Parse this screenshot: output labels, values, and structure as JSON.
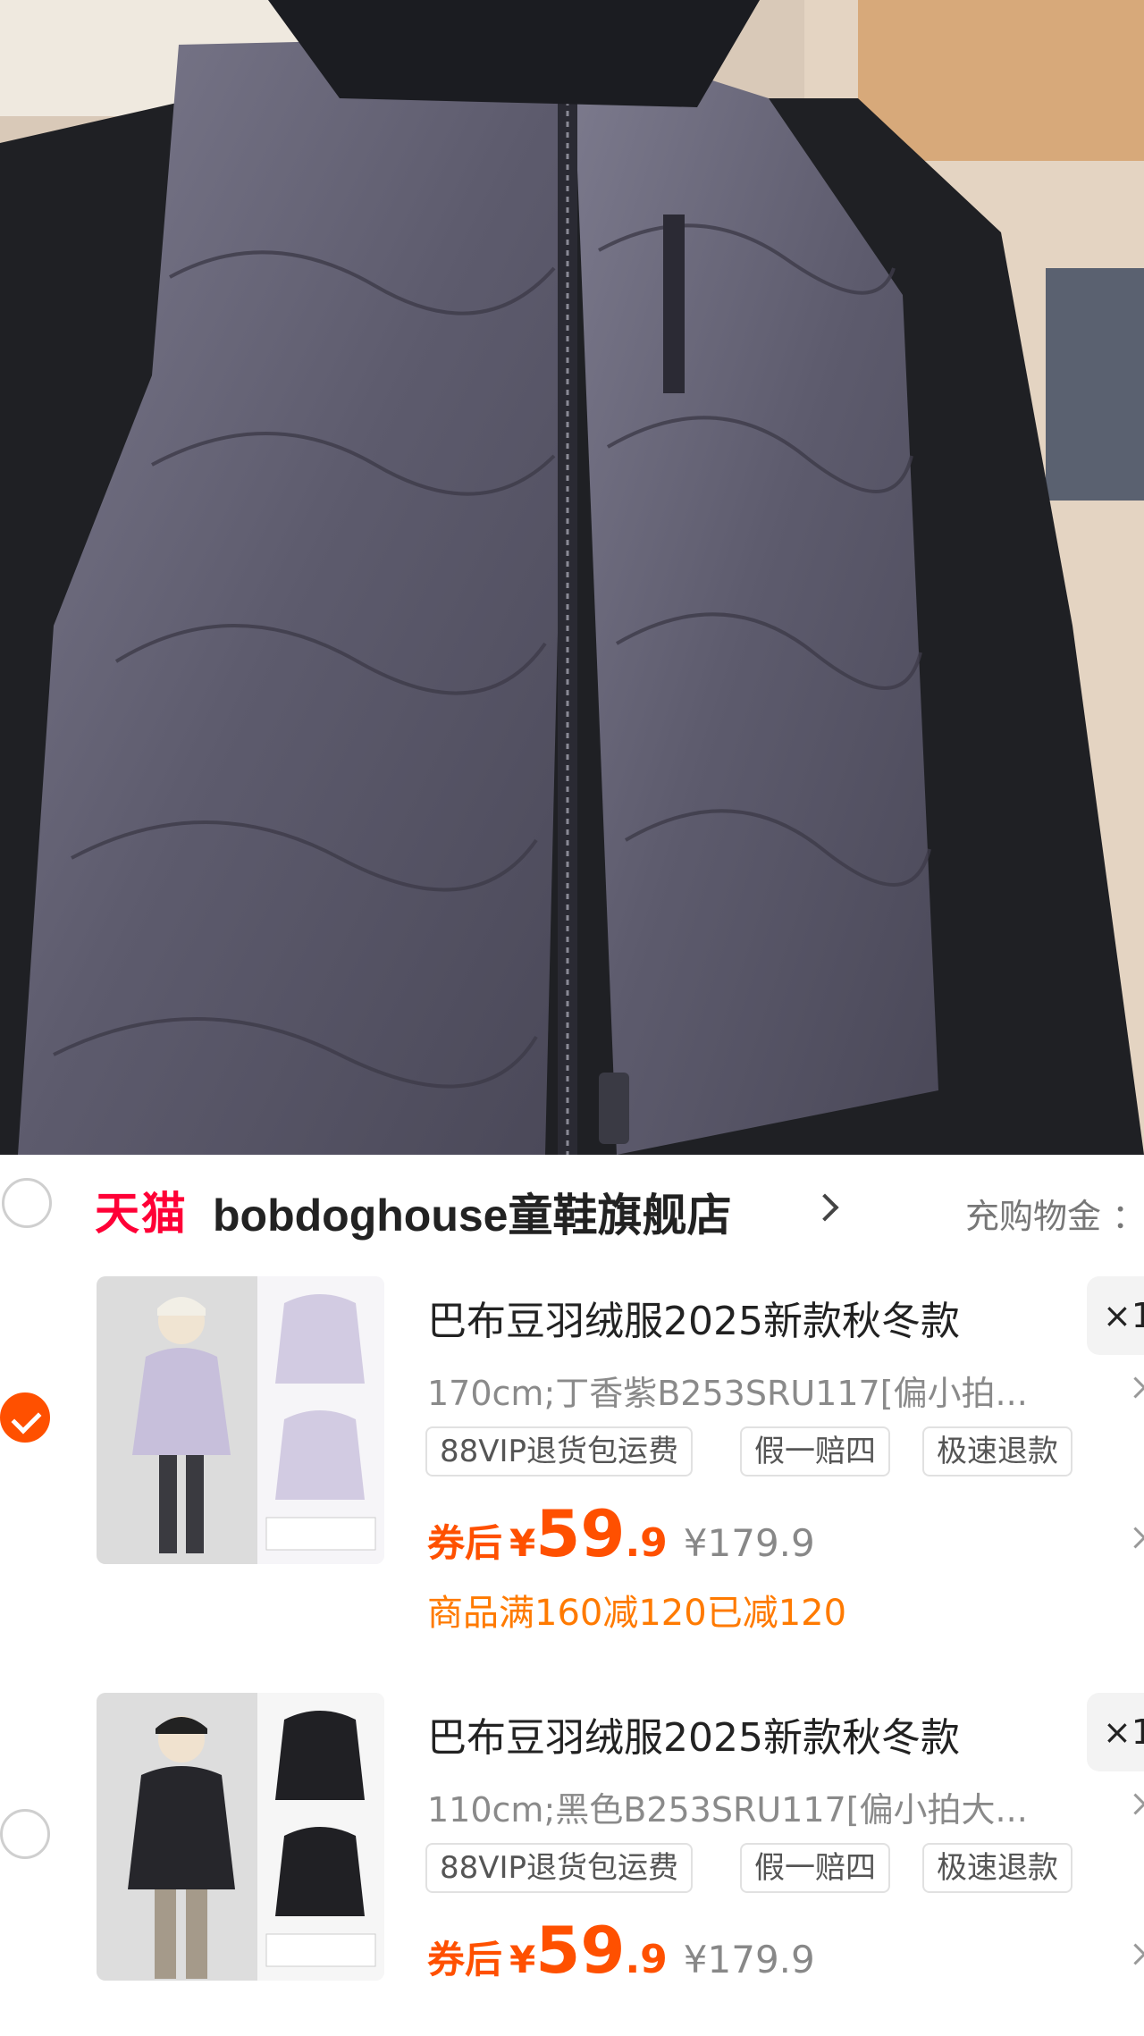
{
  "store": {
    "platform_logo": "天猫",
    "name": "bobdoghouse童鞋旗舰店",
    "action": "充购物金 ："
  },
  "items": [
    {
      "selected": true,
      "title": "巴布豆羽绒服2025新款秋冬款",
      "quantity": "×1",
      "sku": "170cm;丁香紫B253SRU117[偏小拍...",
      "tags": [
        "88VIP退货包运费",
        "假一赔四",
        "极速退款"
      ],
      "price_label": "券后",
      "currency": "¥",
      "price_integer": "59",
      "price_decimal": ".9",
      "original_price": "¥179.9",
      "promo": "商品满160减120已减120",
      "color": "lilac"
    },
    {
      "selected": false,
      "title": "巴布豆羽绒服2025新款秋冬款",
      "quantity": "×1",
      "sku": "110cm;黑色B253SRU117[偏小拍大...",
      "tags": [
        "88VIP退货包运费",
        "假一赔四",
        "极速退款"
      ],
      "price_label": "券后",
      "currency": "¥",
      "price_integer": "59",
      "price_decimal": ".9",
      "original_price": "¥179.9",
      "color": "black"
    }
  ],
  "colors": {
    "accent": "#ff5000",
    "tmall_red": "#ff0036",
    "promo": "#ff7a00"
  }
}
